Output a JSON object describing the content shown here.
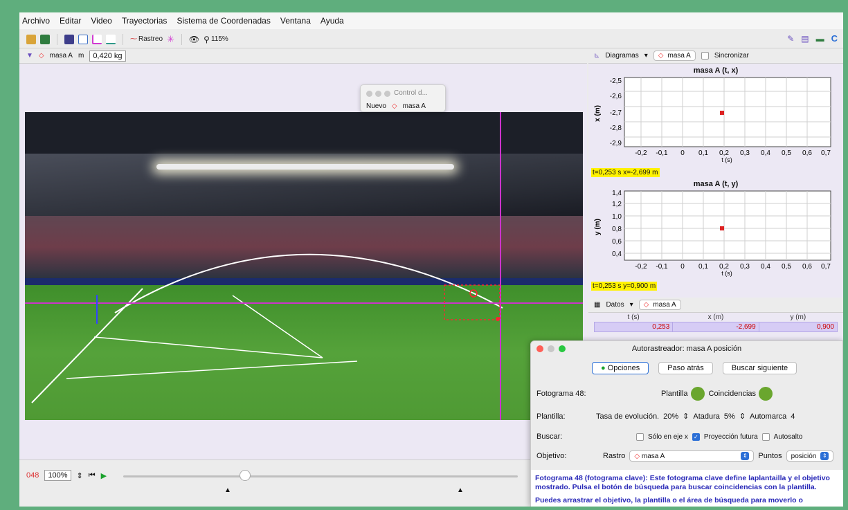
{
  "menu": [
    "Archivo",
    "Editar",
    "Video",
    "Trayectorias",
    "Sistema de Coordenadas",
    "Ventana",
    "Ayuda"
  ],
  "toolbar": {
    "rastreo_label": "Rastreo",
    "zoom_label": "115%"
  },
  "objbar": {
    "object_name": "masa A",
    "mass_label": "m",
    "mass_value": "0,420 kg"
  },
  "control_dialog": {
    "title": "Control d...",
    "new_label": "Nuevo",
    "object_name": "masa A"
  },
  "playback": {
    "frame": "048",
    "zoom": "100%"
  },
  "plots_bar": {
    "menu_label": "Diagramas",
    "object_name": "masa A",
    "sync_label": "Sincronizar"
  },
  "plot_x": {
    "title": "masa A (t, x)",
    "ylabel": "x (m)",
    "xlabel": "t (s)",
    "readout": "t=0,253 s  x=-2,699 m",
    "yticks": [
      "-2,5",
      "-2,6",
      "-2,7",
      "-2,8",
      "-2,9"
    ],
    "xticks": [
      "-0,2",
      "-0,1",
      "0",
      "0,1",
      "0,2",
      "0,3",
      "0,4",
      "0,5",
      "0,6",
      "0,7"
    ]
  },
  "plot_y": {
    "title": "masa A (t, y)",
    "ylabel": "y (m)",
    "xlabel": "t (s)",
    "readout": "t=0,253 s  y=0,900 m",
    "yticks": [
      "1,4",
      "1,2",
      "1,0",
      "0,8",
      "0,6",
      "0,4"
    ],
    "xticks": [
      "-0,2",
      "-0,1",
      "0",
      "0,1",
      "0,2",
      "0,3",
      "0,4",
      "0,5",
      "0,6",
      "0,7"
    ]
  },
  "data_bar": {
    "menu_label": "Datos",
    "object_name": "masa A"
  },
  "table": {
    "headers": [
      "t (s)",
      "x (m)",
      "y (m)"
    ],
    "row": [
      "0,253",
      "-2,699",
      "0,900"
    ]
  },
  "autotracker": {
    "title": "Autorastreador: masa A posición",
    "options_btn": "Opciones",
    "back_btn": "Paso atrás",
    "search_btn": "Buscar siguiente",
    "frame_label": "Fotograma 48:",
    "template_label": "Plantilla",
    "matches_label": "Coincidencias",
    "plantilla_row_label": "Plantilla:",
    "evolution_label": "Tasa de evolución.",
    "evolution_value": "20%",
    "tether_label": "Atadura",
    "tether_value": "5%",
    "automark_label": "Automarca",
    "automark_value": "4",
    "search_row_label": "Buscar:",
    "only_x_label": "Sólo en eje x",
    "future_label": "Proyección futura",
    "autojump_label": "Autosalto",
    "target_label": "Objetivo:",
    "track_label": "Rastro",
    "track_value": "masa A",
    "points_label": "Puntos",
    "points_value": "posición",
    "message": "Fotograma 48 (fotograma clave): Este fotograma clave define laplantailla y el objetivo mostrado. Pulsa el botón de búsqueda para buscar coincidencias con la plantilla.",
    "message2": "Puedes arrastrar el objetivo, la plantilla o el área de búsqueda para moverlo o"
  },
  "colors": {
    "accent": "#cc33cc",
    "track": "#ff3366",
    "highlight": "#fff200"
  }
}
